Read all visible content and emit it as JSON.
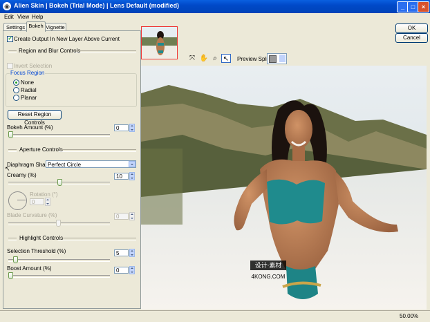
{
  "window": {
    "title": "Alien Skin  |  Bokeh (Trial Mode)  |  Lens Default (modified)",
    "controls": [
      "_",
      "□",
      "×"
    ]
  },
  "menu": [
    "Edit",
    "View",
    "Help"
  ],
  "tabs": [
    "Settings",
    "Bokeh",
    "Vignette"
  ],
  "panel": {
    "create_output": "Create Output In New Layer Above Current",
    "region_header": "Region and Blur Controls",
    "invert_selection": "Invert Selection",
    "focus_region": "Focus Region",
    "radios": [
      "None",
      "Radial",
      "Planar"
    ],
    "reset_button": "Reset Region Controls",
    "bokeh_amount_label": "Bokeh Amount (%)",
    "bokeh_amount_value": "0",
    "aperture_header": "Aperture Controls",
    "diaphragm_label": "Diaphragm Shape:",
    "diaphragm_value": "Perfect Circle",
    "creamy_label": "Creamy (%)",
    "creamy_value": "10",
    "rotation_label": "Rotation (°)",
    "rotation_value": "0",
    "blade_label": "Blade Curvature (%)",
    "blade_value": "0",
    "highlight_header": "Highlight Controls",
    "threshold_label": "Selection Threshold (%)",
    "threshold_value": "5",
    "boost_label": "Boost Amount (%)",
    "boost_value": "0"
  },
  "sliders": {
    "bokeh_amount": 0,
    "creamy": 0.51,
    "blade_curvature": 0.49,
    "selection_threshold": 0.05,
    "boost_amount": 0
  },
  "preview": {
    "split_label": "Preview Split:",
    "tools": [
      "hand-pan-icon",
      "hand-icon",
      "zoom-icon",
      "pointer-icon"
    ],
    "watermark_top": "设计·素材",
    "watermark_bottom": "4KONG.COM"
  },
  "buttons": {
    "ok": "OK",
    "cancel": "Cancel"
  },
  "status": {
    "zoom": "50.00%"
  }
}
